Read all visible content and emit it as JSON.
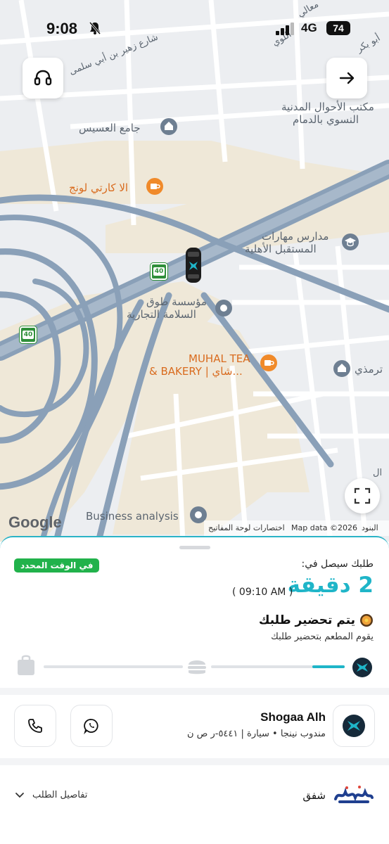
{
  "status_bar": {
    "time": "9:08",
    "network": "4G",
    "battery": "74"
  },
  "map": {
    "labels": {
      "street_top": "شارع زهير بن أبي سلمى",
      "mosque1": "جامع العسيس",
      "office": "مكتب الأحوال المدنية",
      "office2": "النسوي بالدمام",
      "cafe1": "الا كارتي لونج",
      "school1": "مدارس مهارات",
      "school2": "المستقبل الأهلية",
      "foundation1": "مؤسسة طوق",
      "foundation2": "السلامة التجارية",
      "bakery1": "MUHAL TEA",
      "bakery2": "& BAKERY | شاي...",
      "tirmidhi": "ترمذي",
      "business": "Business analysis",
      "top_right1": "معالي",
      "top_right2": "اللوي",
      "top_right3": "أبو بكر",
      "right_edge": "ال"
    },
    "shields": {
      "road1": "40",
      "road2": "40"
    },
    "attribution": {
      "google": "Google",
      "shortcuts": "اختصارات لوحة المفاتيح",
      "map_data": "Map data ©2026",
      "terms": "البنود"
    }
  },
  "order": {
    "badge": "في الوقت المحدد",
    "arrive_label": "طلبك سيصل في:",
    "eta": "2 دقيقة",
    "eta_time": "( 09:10 AM )",
    "prep_title": "يتم تحضير طلبك",
    "prep_sub": "يقوم المطعم بتحضير طلبك",
    "progress": 0.2
  },
  "driver": {
    "name": "Shogaa Alh",
    "subtitle": "مندوب نينجا • سيارة | ٥٤٤١-ر ص ن"
  },
  "restaurant": {
    "name": "شفق",
    "details_label": "تفاصيل الطلب"
  },
  "colors": {
    "accent": "#1fb5c8",
    "badge_green": "#21b24b",
    "poi_orange": "#f08a2a"
  }
}
